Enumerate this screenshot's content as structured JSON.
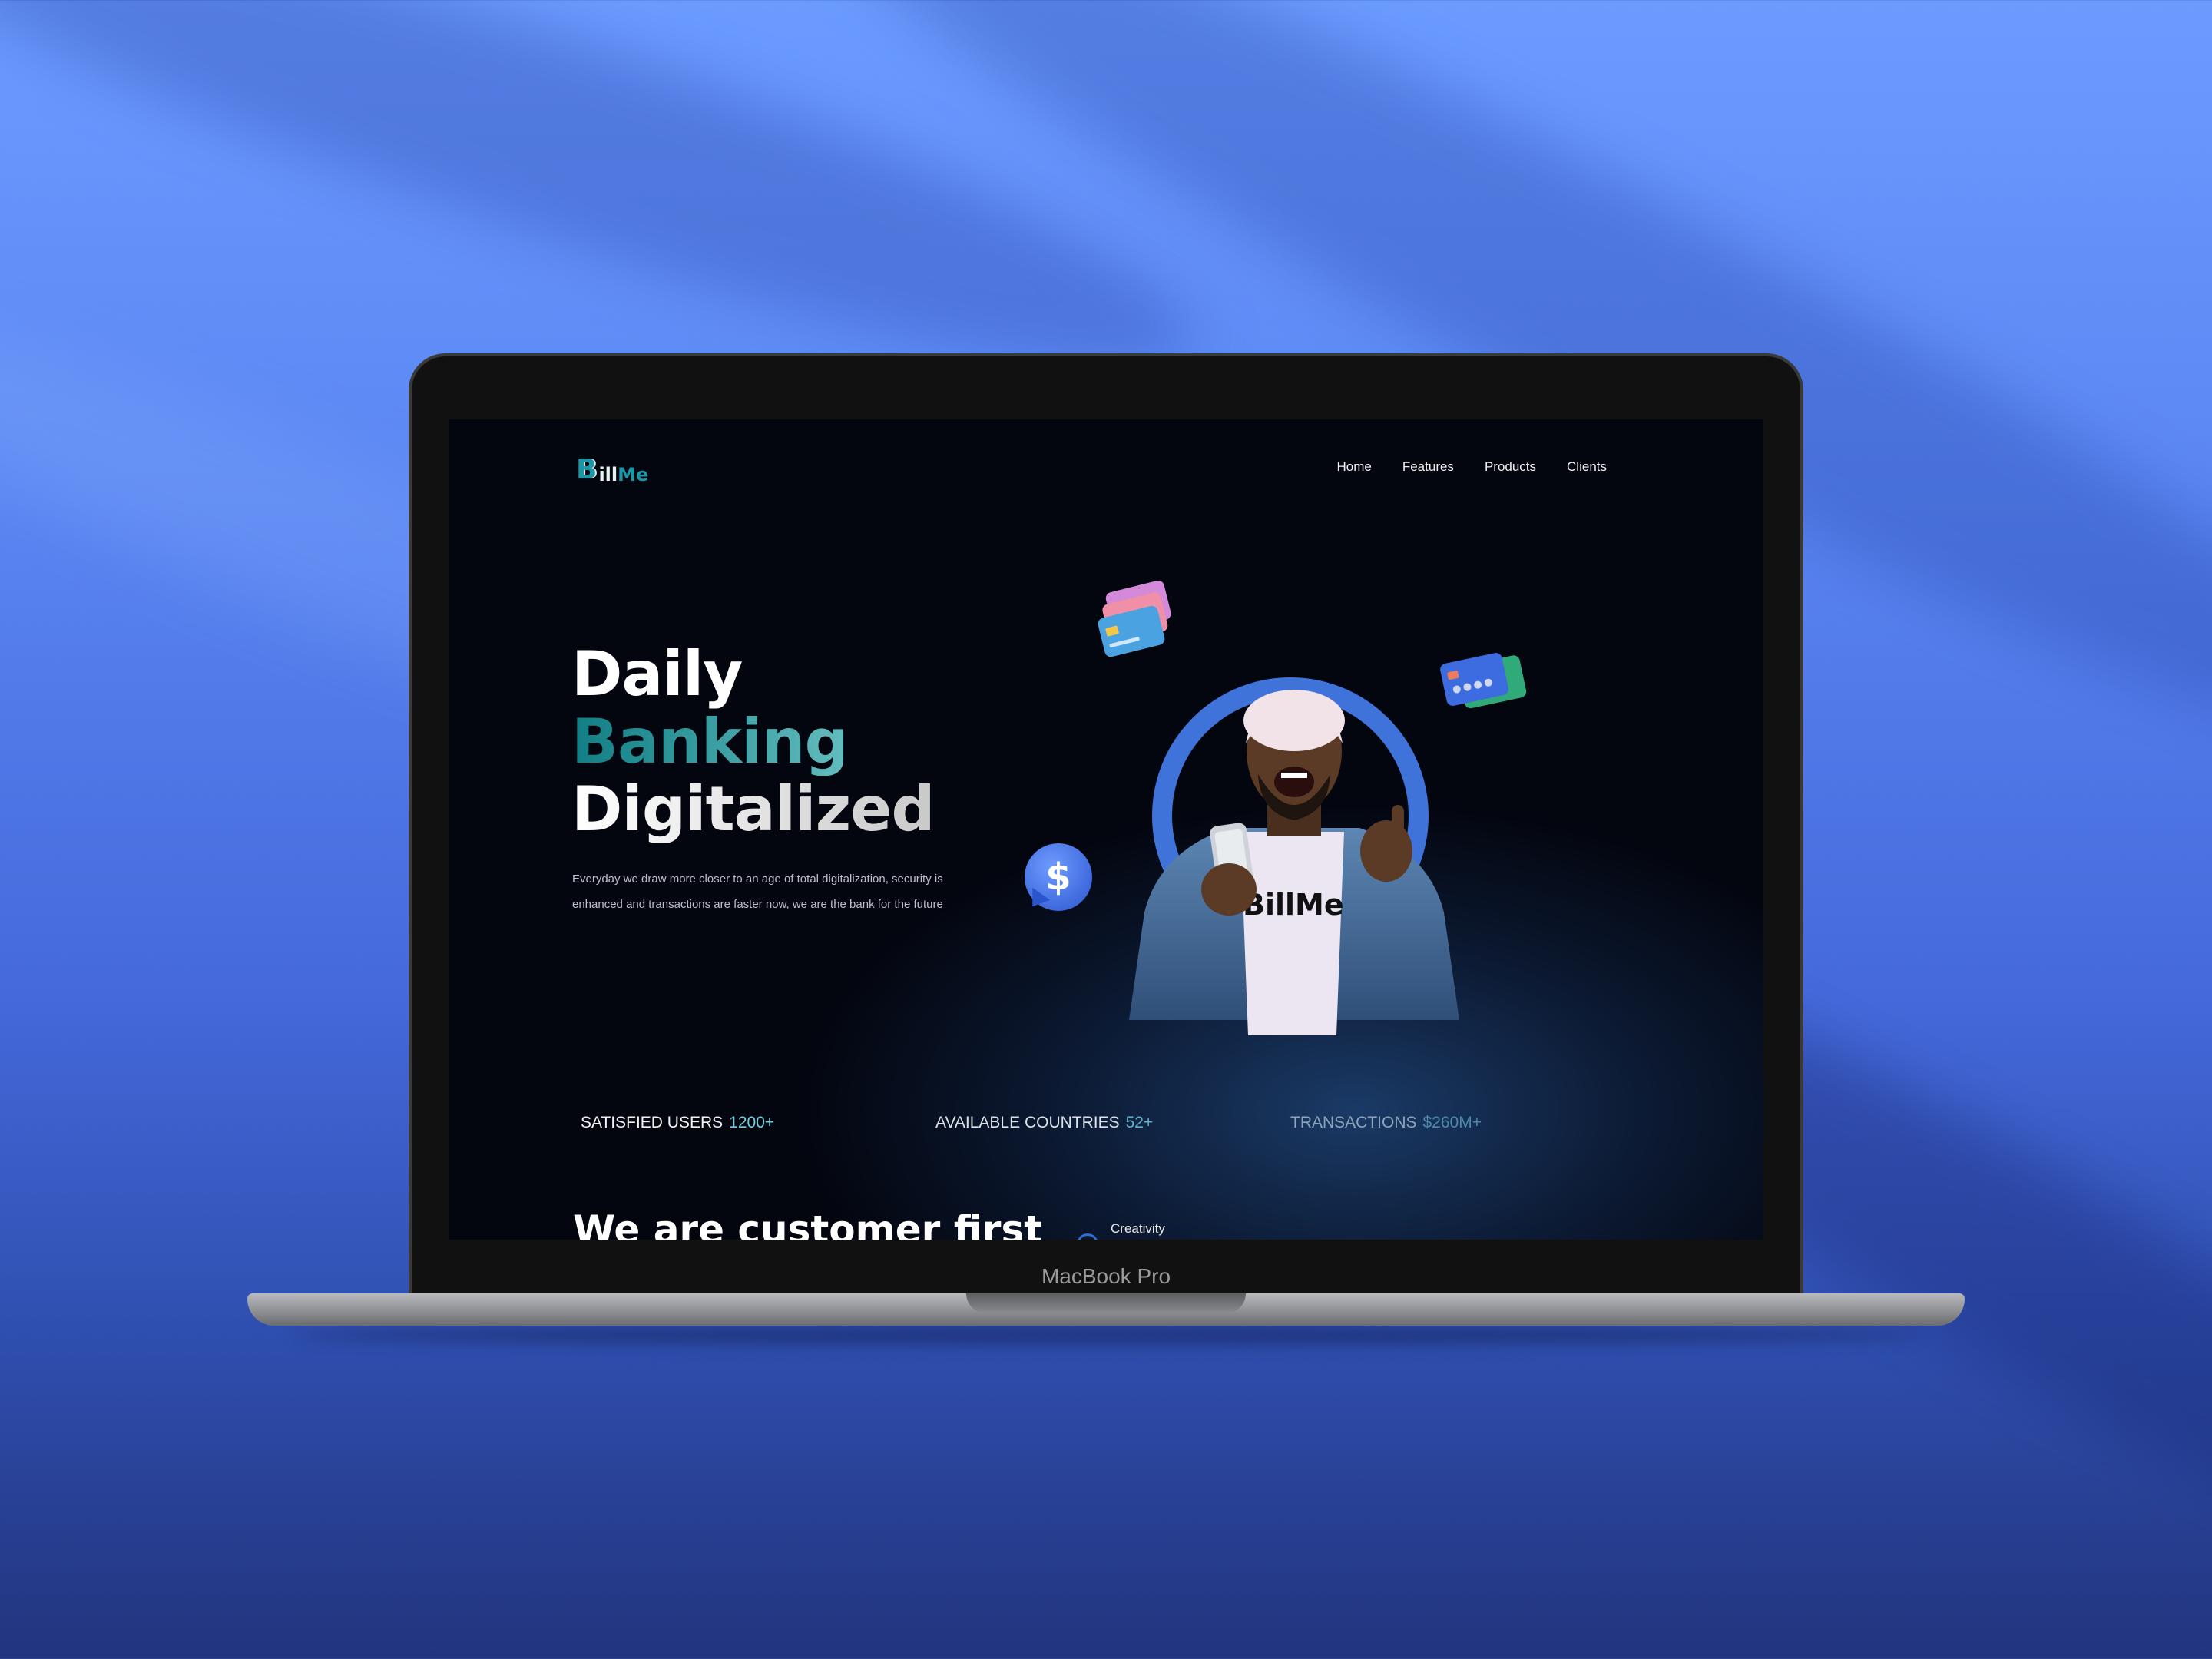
{
  "device": {
    "bezel_label": "MacBook Pro"
  },
  "site": {
    "logo": {
      "initial": "B",
      "word1": "ill",
      "word2": "Me"
    },
    "nav": [
      "Home",
      "Features",
      "Products",
      "Clients"
    ],
    "hero": {
      "title_line1": "Daily",
      "title_line2": "Banking",
      "title_line3": "Digitalized",
      "description": "Everyday we draw more closer to an age of total digitalization, security is enhanced and transactions are faster now, we are the bank for the future",
      "shirt_text": "BillMe",
      "dollar_symbol": "$"
    },
    "stats": [
      {
        "label": "SATISFIED USERS",
        "value": "1200+"
      },
      {
        "label": "AVAILABLE COUNTRIES",
        "value": "52+"
      },
      {
        "label": "TRANSACTIONS",
        "value": "$260M+"
      }
    ],
    "next_section": {
      "title": "We are customer first",
      "tag": "Creativity"
    }
  },
  "colors": {
    "accent_teal": "#1b98a8",
    "accent_blue": "#3f73d9",
    "background": "#02050c"
  }
}
